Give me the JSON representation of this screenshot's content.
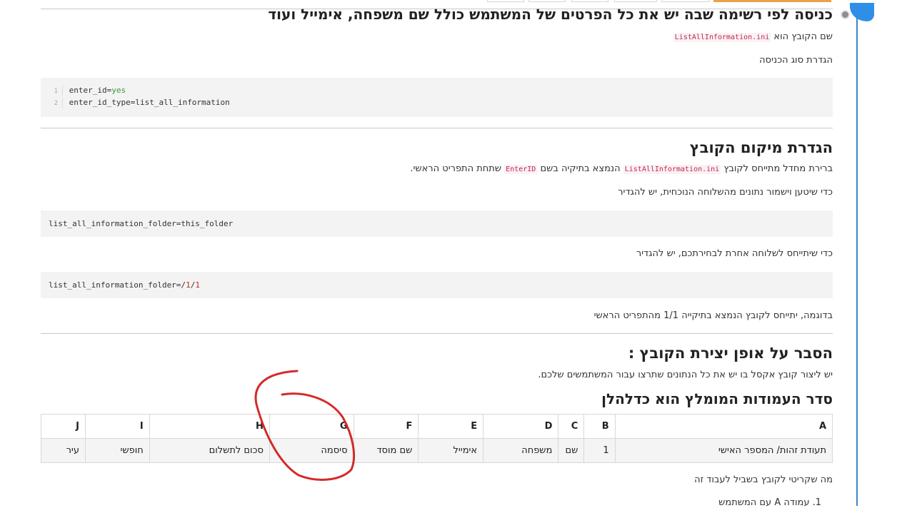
{
  "page": {
    "section1": {
      "title": "כניסה לפי רשימה שבה יש את כל הפרטים של המשתמש כולל שם משפחה, אימייל ועוד",
      "file_prefix": "שם הקובץ הוא",
      "file_name": "ListAllInformation.ini",
      "entry_type_label": "הגדרת סוג הכניסה",
      "code_lines": [
        {
          "num": "1",
          "key": "enter_id=",
          "value": "yes"
        },
        {
          "num": "2",
          "key": "enter_id_type=list_all_information",
          "value": ""
        }
      ]
    },
    "section2": {
      "title": "הגדרת מיקום הקובץ",
      "desc_part1": "ברירת מחדל מתייחס לקובץ",
      "desc_code1": "ListAllInformation.ini",
      "desc_part2": "הנמצא בתיקיה בשם",
      "desc_code2": "EnterID",
      "desc_part3": "שתחת התפריט הראשי.",
      "current_branch_label": "כדי שיטען וישמור נתונים מהשלוחה הנוכחית, יש להגדיר",
      "code_current": "list_all_information_folder=this_folder",
      "other_branch_label": "כדי שיתייחס לשלוחה אחרת לבחירתכם, יש להגדיר",
      "code_other_prefix": "list_all_information_folder=/",
      "code_other_num1": "1",
      "code_other_slash": "/",
      "code_other_num2": "1",
      "example": "בדוגמה, יתייחס לקובץ הנמצא בתיקייה 1/1 מהתפריט הראשי"
    },
    "section3": {
      "title": "הסבר על אופן יצירת הקובץ :",
      "desc": "יש ליצור קובץ אקסל בו יש את כל הנתונים שתרצו עבור המשתמשים שלכם.",
      "subtitle": "סדר העמודות המומלץ הוא כדלהלן",
      "table_headers": [
        "A",
        "B",
        "C",
        "D",
        "E",
        "F",
        "G",
        "H",
        "I",
        "J"
      ],
      "table_row": [
        "תעודת זהות/ המספר האישי",
        "1",
        "שם",
        "משפחה",
        "אימייל",
        "שם מוסד",
        "סיסמה",
        "סכום לתשלום",
        "חופשי",
        "עיר"
      ],
      "script_note": "מה שקריטי לקובץ בשביל לעבוד זה",
      "list_item_1": "1. עמודה A עם המשתמש"
    },
    "colors": {
      "accent": "#2f8fe8",
      "annotation": "#d42a2a",
      "code_pink": "#c7254e"
    }
  }
}
